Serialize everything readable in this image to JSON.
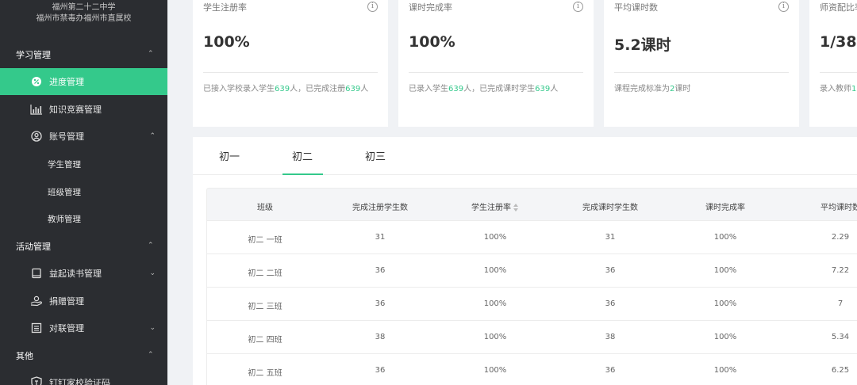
{
  "sidebar": {
    "school_line1": "福州第二十二中学",
    "school_line2": "福州市禁毒办福州市直属校",
    "groups": [
      {
        "label": "学习管理"
      },
      {
        "label": "活动管理"
      },
      {
        "label": "其他"
      }
    ],
    "items": {
      "progress": "进度管理",
      "contest": "知识竞赛管理",
      "account": "账号管理",
      "student": "学生管理",
      "class": "班级管理",
      "teacher": "教师管理",
      "reading": "益起读书管理",
      "donation": "捐赠管理",
      "couplet": "对联管理",
      "dingding": "钉钉家校验证码"
    },
    "accent": "#34c98b"
  },
  "cards": [
    {
      "title": "学生注册率",
      "value": "100%",
      "desc_prefix": "已接入学校录入学生",
      "desc_n1": "639",
      "desc_mid": "人，已完成注册",
      "desc_n2": "639",
      "desc_suffix": "人"
    },
    {
      "title": "课时完成率",
      "value": "100%",
      "desc_prefix": "已录入学生",
      "desc_n1": "639",
      "desc_mid": "人，已完成课时学生",
      "desc_n2": "639",
      "desc_suffix": "人"
    },
    {
      "title": "平均课时数",
      "value": "5.2课时",
      "desc_prefix": "课程完成标准为",
      "desc_n1": "2",
      "desc_mid": "课时",
      "desc_n2": "",
      "desc_suffix": ""
    },
    {
      "title": "师资配比率",
      "value": "1/38",
      "desc_prefix": "录入教师",
      "desc_n1": "1",
      "desc_mid": "",
      "desc_n2": "",
      "desc_suffix": ""
    }
  ],
  "tabs": [
    "初一",
    "初二",
    "初三"
  ],
  "active_tab": "初二",
  "table": {
    "headers": [
      "班级",
      "完成注册学生数",
      "学生注册率",
      "完成课时学生数",
      "课时完成率",
      "平均课时数"
    ],
    "rows": [
      [
        "初二 一班",
        "31",
        "100%",
        "31",
        "100%",
        "2.29"
      ],
      [
        "初二 二班",
        "36",
        "100%",
        "36",
        "100%",
        "7.22"
      ],
      [
        "初二 三班",
        "36",
        "100%",
        "36",
        "100%",
        "7"
      ],
      [
        "初二 四班",
        "38",
        "100%",
        "38",
        "100%",
        "5.34"
      ],
      [
        "初二 五班",
        "36",
        "100%",
        "36",
        "100%",
        "6.25"
      ]
    ]
  }
}
